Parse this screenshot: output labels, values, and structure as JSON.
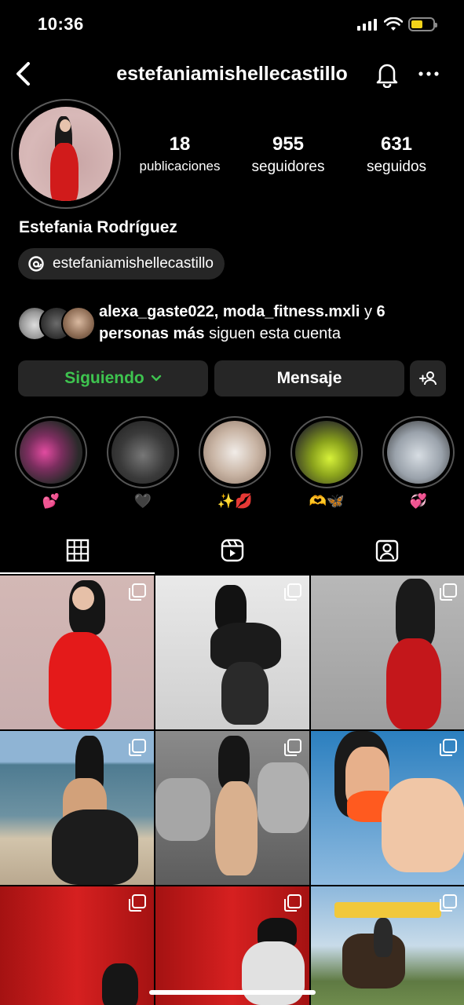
{
  "status_bar": {
    "time": "10:36"
  },
  "header": {
    "username": "estefaniamishellecastillo"
  },
  "profile": {
    "stats": [
      {
        "value": "18",
        "label": "publicaciones"
      },
      {
        "value": "955",
        "label": "seguidores"
      },
      {
        "value": "631",
        "label": "seguidos"
      }
    ],
    "full_name": "Estefania Rodríguez",
    "threads_handle": "estefaniamishellecastillo",
    "followed_by": {
      "names": "alexa_gaste022, moda_fitness.mxli",
      "connector": " y ",
      "others_bold": "6 personas más",
      "suffix": " siguen esta cuenta"
    }
  },
  "actions": {
    "following_label": "Siguiendo",
    "message_label": "Mensaje"
  },
  "highlights": [
    {
      "label": "💕"
    },
    {
      "label": "🖤"
    },
    {
      "label": "✨💋"
    },
    {
      "label": "🫶🦋"
    },
    {
      "label": "💞"
    }
  ],
  "colors": {
    "following_green": "#3ec44f",
    "button_bg": "#262626",
    "battery": "#f1d31a"
  },
  "icons": [
    "back-arrow-icon",
    "bell-icon",
    "more-icon",
    "threads-icon",
    "chevron-down-icon",
    "add-person-icon",
    "grid-icon",
    "reels-icon",
    "tagged-icon"
  ]
}
